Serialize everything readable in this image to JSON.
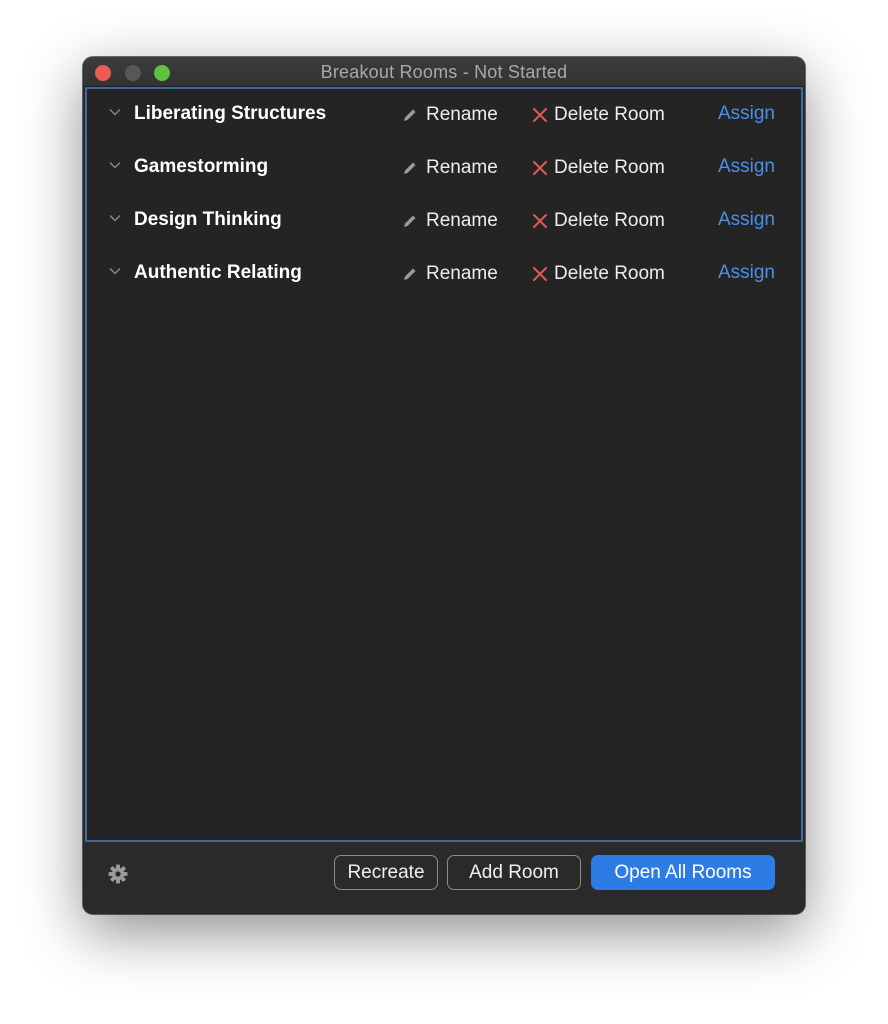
{
  "window": {
    "title": "Breakout Rooms - Not Started"
  },
  "rooms": [
    {
      "name": "Liberating Structures",
      "rename_label": "Rename",
      "delete_label": "Delete Room",
      "assign_label": "Assign"
    },
    {
      "name": "Gamestorming",
      "rename_label": "Rename",
      "delete_label": "Delete Room",
      "assign_label": "Assign"
    },
    {
      "name": "Design Thinking",
      "rename_label": "Rename",
      "delete_label": "Delete Room",
      "assign_label": "Assign"
    },
    {
      "name": "Authentic Relating",
      "rename_label": "Rename",
      "delete_label": "Delete Room",
      "assign_label": "Assign"
    }
  ],
  "footer": {
    "recreate_label": "Recreate",
    "add_room_label": "Add Room",
    "open_all_label": "Open All Rooms"
  },
  "icons": {
    "chevron": "chevron-down-icon",
    "rename": "pencil-icon",
    "delete": "close-icon",
    "settings": "gear-icon"
  },
  "colors": {
    "accent": "#2d7ce6",
    "link": "#4a8fe7",
    "delete": "#e05a52",
    "focus_border": "#3e6a9e"
  }
}
